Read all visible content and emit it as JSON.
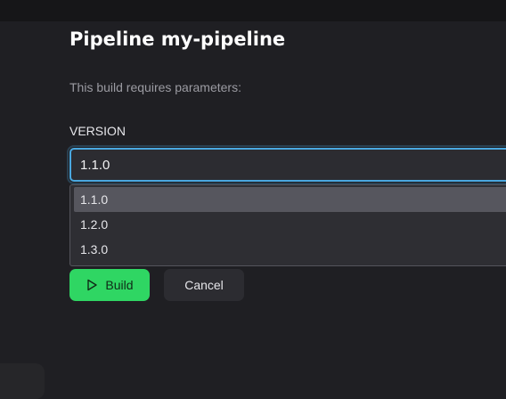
{
  "page": {
    "title": "Pipeline my-pipeline",
    "subtitle": "This build requires parameters:"
  },
  "parameter": {
    "label": "VERSION",
    "value": "1.1.0",
    "options": [
      "1.1.0",
      "1.2.0",
      "1.3.0"
    ],
    "highlighted_option": "1.1.0"
  },
  "actions": {
    "build_label": "Build",
    "cancel_label": "Cancel",
    "build_icon": "play-icon"
  },
  "colors": {
    "accent_green": "#2fd663",
    "focus_blue": "#4aa8e0"
  }
}
